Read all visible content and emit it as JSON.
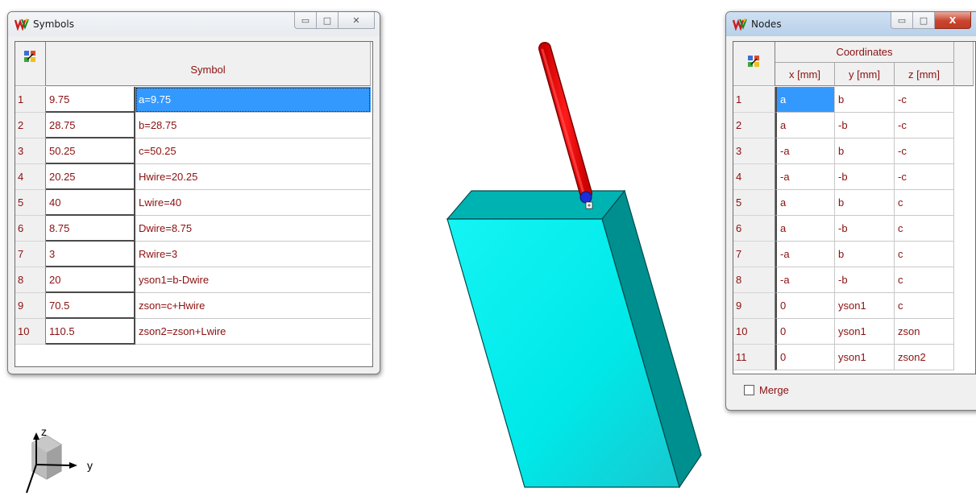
{
  "symbols_window": {
    "title": "Symbols",
    "controls": {
      "minimize": "▭",
      "maximize": "□",
      "close": "✕"
    },
    "column_header": "Symbol",
    "rows": [
      {
        "num": "1",
        "value": "9.75",
        "expr": "a=9.75",
        "selected": true
      },
      {
        "num": "2",
        "value": "28.75",
        "expr": "b=28.75"
      },
      {
        "num": "3",
        "value": "50.25",
        "expr": "c=50.25"
      },
      {
        "num": "4",
        "value": "20.25",
        "expr": "Hwire=20.25"
      },
      {
        "num": "5",
        "value": "40",
        "expr": "Lwire=40"
      },
      {
        "num": "6",
        "value": "8.75",
        "expr": "Dwire=8.75"
      },
      {
        "num": "7",
        "value": "3",
        "expr": "Rwire=3"
      },
      {
        "num": "8",
        "value": "20",
        "expr": "yson1=b-Dwire"
      },
      {
        "num": "9",
        "value": "70.5",
        "expr": "zson=c+Hwire"
      },
      {
        "num": "10",
        "value": "110.5",
        "expr": "zson2=zson+Lwire"
      }
    ]
  },
  "nodes_window": {
    "title": "Nodes",
    "controls": {
      "minimize": "▭",
      "maximize": "□",
      "close": "X"
    },
    "group_header": "Coordinates",
    "columns": [
      "x [mm]",
      "y [mm]",
      "z [mm]"
    ],
    "rows": [
      {
        "num": "1",
        "x": "a",
        "y": "b",
        "z": "-c",
        "selected": true
      },
      {
        "num": "2",
        "x": "a",
        "y": "-b",
        "z": "-c"
      },
      {
        "num": "3",
        "x": "-a",
        "y": "b",
        "z": "-c"
      },
      {
        "num": "4",
        "x": "-a",
        "y": "-b",
        "z": "-c"
      },
      {
        "num": "5",
        "x": "a",
        "y": "b",
        "z": "c"
      },
      {
        "num": "6",
        "x": "a",
        "y": "-b",
        "z": "c"
      },
      {
        "num": "7",
        "x": "-a",
        "y": "b",
        "z": "c"
      },
      {
        "num": "8",
        "x": "-a",
        "y": "-b",
        "z": "c"
      },
      {
        "num": "9",
        "x": "0",
        "y": "yson1",
        "z": "c"
      },
      {
        "num": "10",
        "x": "0",
        "y": "yson1",
        "z": "zson"
      },
      {
        "num": "11",
        "x": "0",
        "y": "yson1",
        "z": "zson2"
      }
    ],
    "merge_label": "Merge",
    "merge_checked": false
  },
  "axes_triad": {
    "z_label": "z",
    "y_label": "y"
  },
  "colors": {
    "grid_text": "#8b1010",
    "selection": "#3399ff",
    "box_front": "#00ffff",
    "box_top": "#00b5b5",
    "box_side": "#008a8a",
    "wire": "#ff0000",
    "probe": "#1b2ed8"
  }
}
